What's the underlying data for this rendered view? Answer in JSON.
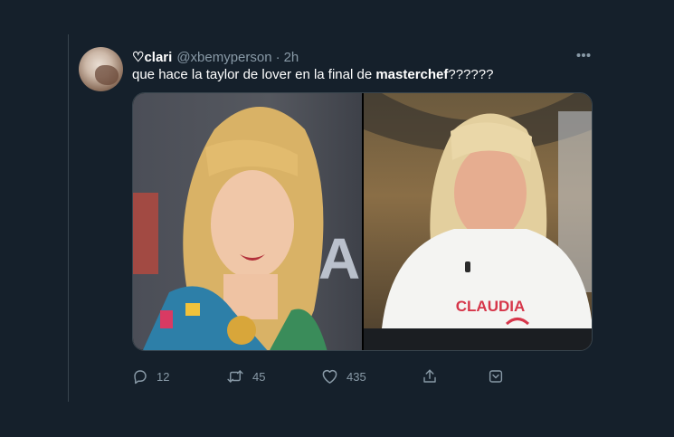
{
  "tweet": {
    "display_name": "♡clari",
    "handle": "@xbemyperson",
    "separator": "·",
    "time": "2h",
    "text_before": "que hace la taylor de lover en la final de ",
    "text_bold": "masterchef",
    "text_after": "??????",
    "more_icon": "more-horizontal-icon"
  },
  "media": {
    "right_photo_badge": "CLAUDIA",
    "left_photo_backdrop_text": "A"
  },
  "actions": {
    "reply": {
      "icon": "reply-icon",
      "count": "12"
    },
    "retweet": {
      "icon": "retweet-icon",
      "count": "45"
    },
    "like": {
      "icon": "heart-icon",
      "count": "435"
    },
    "share": {
      "icon": "share-icon",
      "count": ""
    },
    "save": {
      "icon": "bookmark-icon",
      "count": ""
    }
  },
  "colors": {
    "background": "#15202b",
    "secondary_text": "#8899a6",
    "border": "#38444d",
    "badge_red": "#d6364a"
  }
}
